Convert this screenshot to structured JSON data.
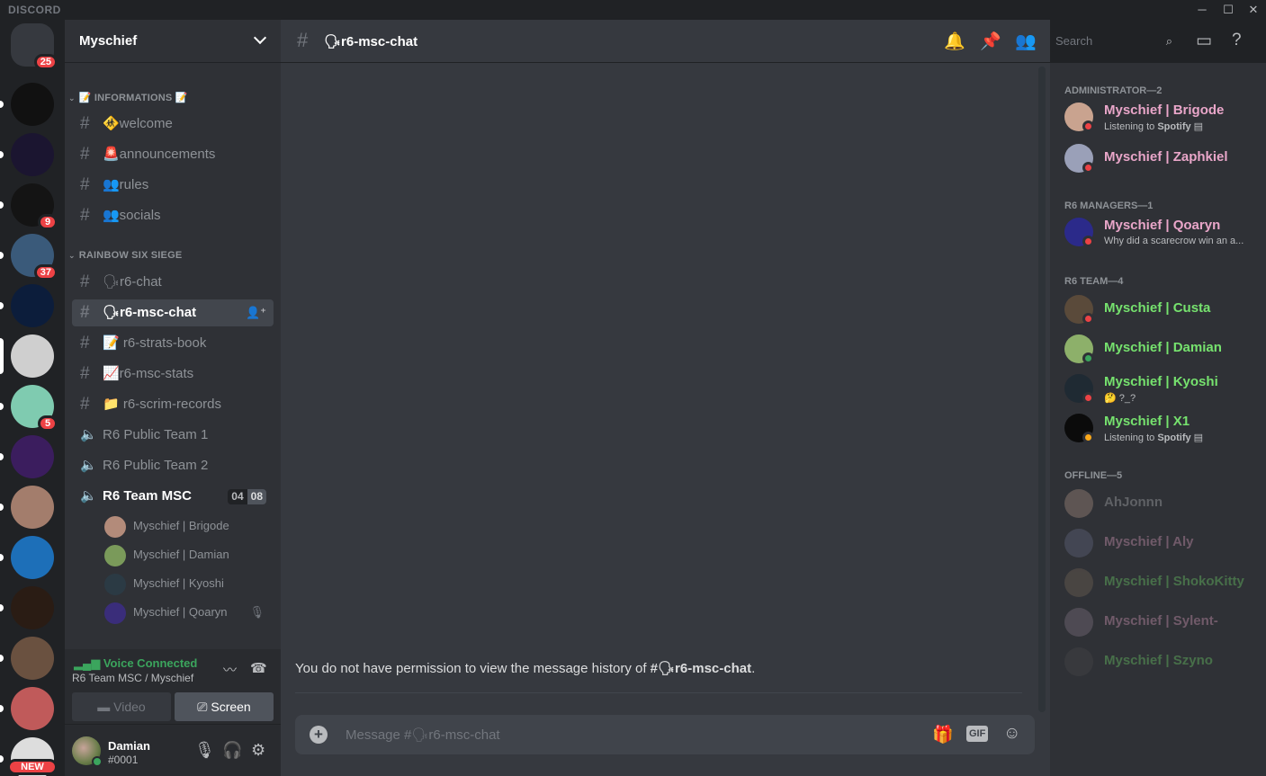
{
  "window": {
    "brand": "DISCORD",
    "controls": {
      "minimize": "─",
      "maximize": "☐",
      "close": "✕"
    }
  },
  "servers": [
    {
      "name": "home",
      "badge": "25",
      "color": "#36393f"
    },
    {
      "name": "server-2",
      "badge": "",
      "color": "#111111"
    },
    {
      "name": "server-3",
      "badge": "",
      "color": "#1b1530"
    },
    {
      "name": "server-4",
      "badge": "9",
      "color": "#141414"
    },
    {
      "name": "server-5",
      "badge": "37",
      "color": "#3a5a7a"
    },
    {
      "name": "server-6",
      "badge": "",
      "color": "#0c1d3b"
    },
    {
      "name": "myschief",
      "badge": "",
      "color": "#cfcfcf",
      "selected": true
    },
    {
      "name": "server-8",
      "badge": "5",
      "color": "#7fcbb0"
    },
    {
      "name": "server-9",
      "badge": "",
      "color": "#3b1d5e"
    },
    {
      "name": "server-10",
      "badge": "",
      "color": "#a37d6c"
    },
    {
      "name": "server-11",
      "badge": "",
      "color": "#1d6fb8"
    },
    {
      "name": "server-12",
      "badge": "",
      "color": "#2a1c14"
    },
    {
      "name": "server-13",
      "badge": "",
      "color": "#6a5140"
    },
    {
      "name": "server-14",
      "badge": "",
      "color": "#c05a5a"
    },
    {
      "name": "server-15",
      "badge": "NEW",
      "color": "#dddddd"
    }
  ],
  "guild": {
    "name": "Myschief"
  },
  "categories": {
    "informations": "📝 INFORMATIONS 📝",
    "r6": "RAINBOW SIX SIEGE"
  },
  "channels_info": [
    {
      "name": "🚸welcome"
    },
    {
      "name": "🚨announcements"
    },
    {
      "name": "👥rules"
    },
    {
      "name": "👥socials"
    }
  ],
  "channels_r6": [
    {
      "name": "🗣r6-chat"
    },
    {
      "name": "🗣r6-msc-chat",
      "selected": true
    },
    {
      "name": "📝 r6-strats-book"
    },
    {
      "name": "📈r6-msc-stats"
    },
    {
      "name": "📁 r6-scrim-records"
    }
  ],
  "voice_channels": [
    {
      "name": "R6 Public Team 1"
    },
    {
      "name": "R6 Public Team 2"
    },
    {
      "name": "R6 Team MSC",
      "count_a": "04",
      "count_b": "08"
    }
  ],
  "voice_users": [
    {
      "name": "Myschief | Brigode"
    },
    {
      "name": "Myschief | Damian"
    },
    {
      "name": "Myschief | Kyoshi"
    },
    {
      "name": "Myschief | Qoaryn"
    }
  ],
  "voice_panel": {
    "status": "Voice Connected",
    "location": "R6 Team MSC / Myschief",
    "video_label": "Video",
    "screen_label": "Screen"
  },
  "user_panel": {
    "name": "Damian",
    "tag": "#0001"
  },
  "chat": {
    "channel_title": "🗣r6-msc-chat",
    "search_placeholder": "Search",
    "permission_text_prefix": "You do not have permission to view the message history of ",
    "permission_channel": "#🗣r6-msc-chat",
    "permission_text_suffix": ".",
    "composer_placeholder": "Message #🗣r6-msc-chat",
    "gif_label": "GIF"
  },
  "members": {
    "groups": [
      {
        "title": "ADMINISTRATOR—2"
      },
      {
        "title": "R6 MANAGERS—1"
      },
      {
        "title": "R6 TEAM—4"
      },
      {
        "title": "OFFLINE—5"
      }
    ],
    "admin": [
      {
        "name": "Myschief | Brigode",
        "activity_prefix": "Listening to ",
        "activity_bold": "Spotify",
        "status": "dnd",
        "color": "#e9a6c9"
      },
      {
        "name": "Myschief | Zaphkiel",
        "activity_prefix": "",
        "activity_bold": "",
        "status": "dnd",
        "color": "#e9a6c9"
      }
    ],
    "managers": [
      {
        "name": "Myschief | Qoaryn",
        "activity_prefix": "Why did a scarecrow win an a...",
        "activity_bold": "",
        "status": "dnd",
        "color": "#e9a6c9"
      }
    ],
    "team": [
      {
        "name": "Myschief | Custa",
        "activity_prefix": "",
        "activity_bold": "",
        "status": "dnd",
        "color": "#76e26e"
      },
      {
        "name": "Myschief | Damian",
        "activity_prefix": "",
        "activity_bold": "",
        "status": "online",
        "color": "#76e26e"
      },
      {
        "name": "Myschief | Kyoshi",
        "activity_prefix": "🤔 ?_?",
        "activity_bold": "",
        "status": "dnd",
        "color": "#76e26e"
      },
      {
        "name": "Myschief | X1",
        "activity_prefix": "Listening to ",
        "activity_bold": "Spotify",
        "status": "idle",
        "color": "#76e26e"
      }
    ],
    "offline": [
      {
        "name": "AhJonnn",
        "color": "#b9bbbe"
      },
      {
        "name": "Myschief | Aly",
        "color": "#e9a6c9"
      },
      {
        "name": "Myschief | ShokoKitty",
        "color": "#76e26e"
      },
      {
        "name": "Myschief | Sylent-",
        "color": "#e9a6c9"
      },
      {
        "name": "Myschief | Szyno",
        "color": "#76e26e"
      }
    ]
  }
}
